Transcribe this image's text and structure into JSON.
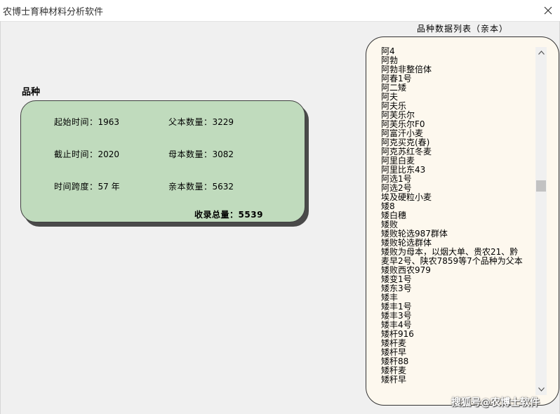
{
  "window": {
    "title": "农博士育种材料分析软件"
  },
  "stats": {
    "section_title": "品种",
    "start_label": "起始时间：",
    "start_value": "1963",
    "end_label": "截止时间：",
    "end_value": "2020",
    "span_label": "时间跨度：",
    "span_value": "57 年",
    "father_label": "父本数量：",
    "father_value": "3229",
    "mother_label": "母本数量：",
    "mother_value": "3082",
    "parent_label": "亲本数量：",
    "parent_value": "5632",
    "total_label": "收录总量：",
    "total_value": "5539"
  },
  "varieties": {
    "title": "品种数据列表（亲本）",
    "items": [
      "阿4",
      "阿勃",
      "阿勃非整倍体",
      "阿春1号",
      "阿二矮",
      "阿夫",
      "阿夫乐",
      "阿芙乐尔",
      "阿芙乐尔F0",
      "阿富汗小麦",
      "阿克买克(春)",
      "阿克苏红冬麦",
      "阿里白麦",
      "阿里比东43",
      "阿选1号",
      "阿选2号",
      "埃及硬粒小麦",
      "矮8",
      "矮白穗",
      "矮败",
      "矮败轮选987群体",
      "矮败轮选群体",
      "矮败为母本，以烟大单、贵农21、黔",
      "麦早2号、陕农7859等7个品种为父本",
      "矮败西农979",
      "矮变1号",
      "矮东3号",
      "矮丰",
      "矮丰1号",
      "矮丰3号",
      "矮丰4号",
      "矮杆916",
      "矮杆麦",
      "矮杆早",
      "矮秆88",
      "矮秆麦",
      "矮秆早"
    ]
  },
  "watermark": "搜狐号@农博士软件",
  "colors": {
    "card_bg": "#c0dbbd",
    "list_bg": "#fdf8ee",
    "window_bg": "#f0f0f0"
  },
  "icons": {
    "close": "close-icon",
    "scroll_up": "scroll-up-arrow-icon",
    "scroll_down": "scroll-down-arrow-icon"
  }
}
